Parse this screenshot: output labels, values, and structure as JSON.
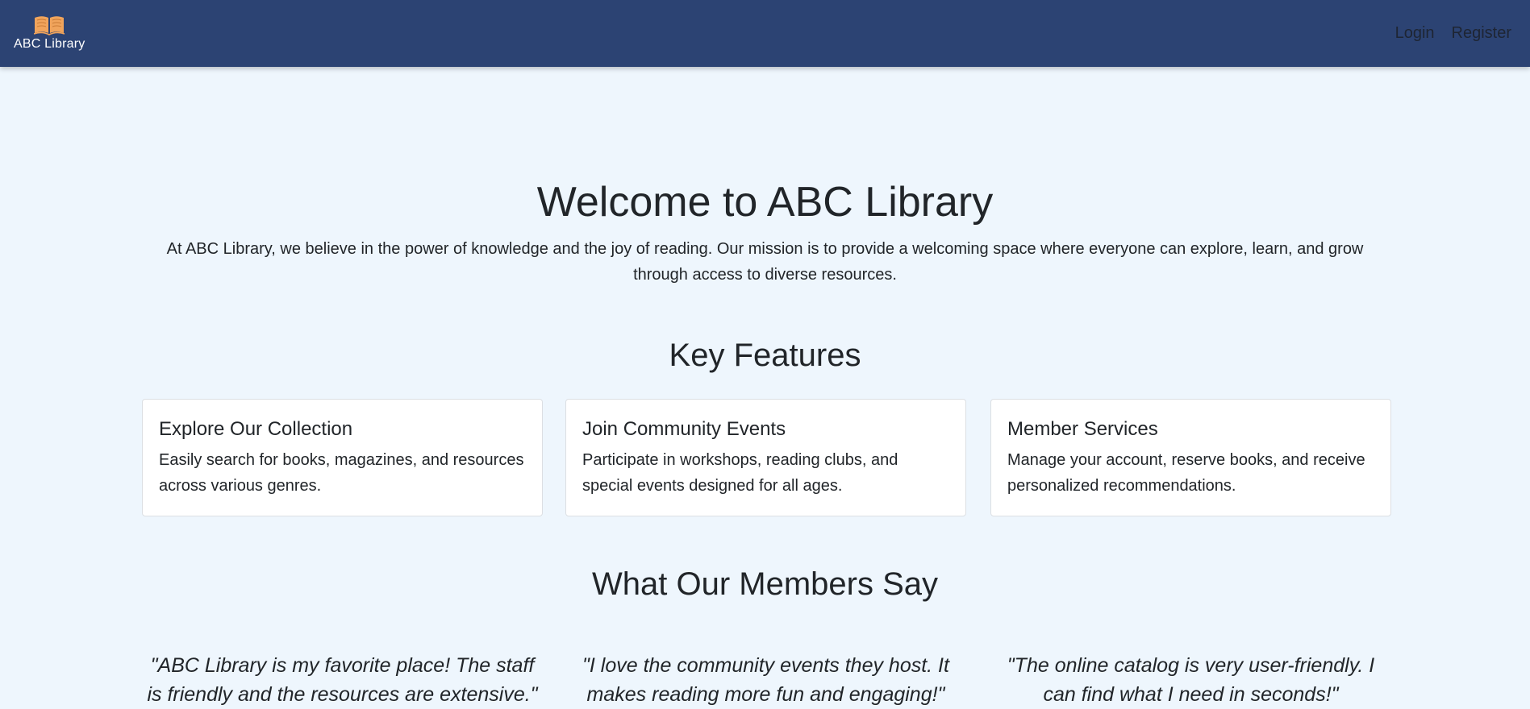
{
  "navbar": {
    "brand": {
      "name": "ABC Library",
      "icon": "open-book-icon",
      "icon_color": "#f0a45c"
    },
    "links": {
      "login": "Login",
      "register": "Register"
    },
    "background_color": "#2c4373"
  },
  "hero": {
    "title": "Welcome to ABC Library",
    "description": "At ABC Library, we believe in the power of knowledge and the joy of reading. Our mission is to provide a welcoming space where everyone can explore, learn, and grow through access to diverse resources."
  },
  "features": {
    "title": "Key Features",
    "items": [
      {
        "title": "Explore Our Collection",
        "text": "Easily search for books, magazines, and resources across various genres."
      },
      {
        "title": "Join Community Events",
        "text": "Participate in workshops, reading clubs, and special events designed for all ages."
      },
      {
        "title": "Member Services",
        "text": "Manage your account, reserve books, and receive personalized recommendations."
      }
    ]
  },
  "testimonials": {
    "title": "What Our Members Say",
    "items": [
      "\"ABC Library is my favorite place! The staff is friendly and the resources are extensive.\"",
      "\"I love the community events they host. It makes reading more fun and engaging!\"",
      "\"The online catalog is very user-friendly. I can find what I need in seconds!\""
    ]
  },
  "page_background": "#eef6fd"
}
